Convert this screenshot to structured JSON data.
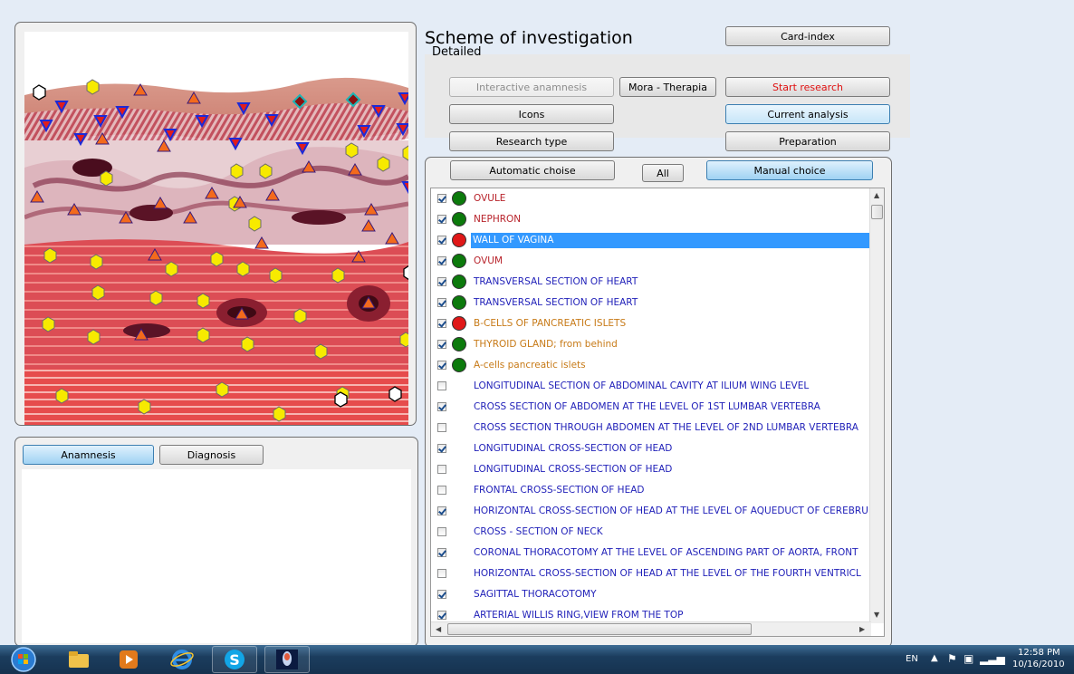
{
  "header": {
    "title": "Scheme of investigation",
    "subtitle": "Detailed"
  },
  "toolbar": {
    "card_index": "Card-index",
    "interactive_anamnesis": "Interactive anamnesis",
    "mora_therapia": "Mora - Therapia",
    "start_research": "Start research",
    "icons": "Icons",
    "current_analysis": "Current analysis",
    "research_type": "Research type",
    "preparation": "Preparation"
  },
  "selector": {
    "automatic": "Automatic choise",
    "all": "All",
    "manual": "Manual choice"
  },
  "bottom_tabs": {
    "anamnesis": "Anamnesis",
    "diagnosis": "Diagnosis"
  },
  "list": {
    "items": [
      {
        "label": "OVULE",
        "checked": true,
        "status": "green",
        "color": "#b8232b"
      },
      {
        "label": "NEPHRON",
        "checked": true,
        "status": "green",
        "color": "#b8232b"
      },
      {
        "label": "WALL OF VAGINA",
        "checked": true,
        "status": "red",
        "color": "#b8232b",
        "selected": true
      },
      {
        "label": "OVUM",
        "checked": true,
        "status": "green",
        "color": "#b8232b"
      },
      {
        "label": "TRANSVERSAL SECTION OF HEART",
        "checked": true,
        "status": "green",
        "color": "#1f1fb8"
      },
      {
        "label": "TRANSVERSAL SECTION OF HEART",
        "checked": true,
        "status": "green",
        "color": "#1f1fb8"
      },
      {
        "label": "B-CELLS OF PANCREATIC ISLETS",
        "checked": true,
        "status": "red",
        "color": "#c77a17"
      },
      {
        "label": "THYROID GLAND; from behind",
        "checked": true,
        "status": "green",
        "color": "#c77a17"
      },
      {
        "label": "A-cells pancreatic islets",
        "checked": true,
        "status": "green",
        "color": "#c77a17"
      },
      {
        "label": "LONGITUDINAL SECTION OF ABDOMINAL CAVITY AT ILIUM WING LEVEL",
        "checked": false,
        "status": "none",
        "color": "#1f1fb8"
      },
      {
        "label": "CROSS SECTION OF ABDOMEN AT THE LEVEL OF 1ST LUMBAR VERTEBRA",
        "checked": true,
        "status": "none",
        "color": "#1f1fb8"
      },
      {
        "label": "CROSS SECTION THROUGH ABDOMEN AT THE LEVEL OF 2ND LUMBAR VERTEBRA",
        "checked": false,
        "status": "none",
        "color": "#1f1fb8"
      },
      {
        "label": "LONGITUDINAL CROSS-SECTION OF HEAD",
        "checked": true,
        "status": "none",
        "color": "#1f1fb8"
      },
      {
        "label": "LONGITUDINAL CROSS-SECTION OF HEAD",
        "checked": false,
        "status": "none",
        "color": "#1f1fb8"
      },
      {
        "label": "FRONTAL CROSS-SECTION OF HEAD",
        "checked": false,
        "status": "none",
        "color": "#1f1fb8"
      },
      {
        "label": "HORIZONTAL CROSS-SECTION OF HEAD AT THE LEVEL OF AQUEDUCT OF CEREBRU",
        "checked": true,
        "status": "none",
        "color": "#1f1fb8"
      },
      {
        "label": "CROSS - SECTION  OF   NECK",
        "checked": false,
        "status": "none",
        "color": "#1f1fb8"
      },
      {
        "label": "CORONAL THORACOTOMY AT THE LEVEL OF ASCENDING PART OF AORTA, FRONT",
        "checked": true,
        "status": "none",
        "color": "#1f1fb8"
      },
      {
        "label": "HORIZONTAL CROSS-SECTION OF HEAD AT THE LEVEL OF THE FOURTH VENTRICL",
        "checked": false,
        "status": "none",
        "color": "#1f1fb8"
      },
      {
        "label": "SAGITTAL THORACOTOMY",
        "checked": true,
        "status": "none",
        "color": "#1f1fb8"
      },
      {
        "label": "ARTERIAL WILLIS RING,VIEW FROM THE TOP",
        "checked": true,
        "status": "none",
        "color": "#1f1fb8"
      }
    ]
  },
  "tray": {
    "lang": "EN",
    "time": "12:58 PM",
    "date": "10/16/2010"
  },
  "colors": {
    "status_green": "#0c7a0c",
    "status_red": "#e01818",
    "selection": "#3399ff"
  }
}
